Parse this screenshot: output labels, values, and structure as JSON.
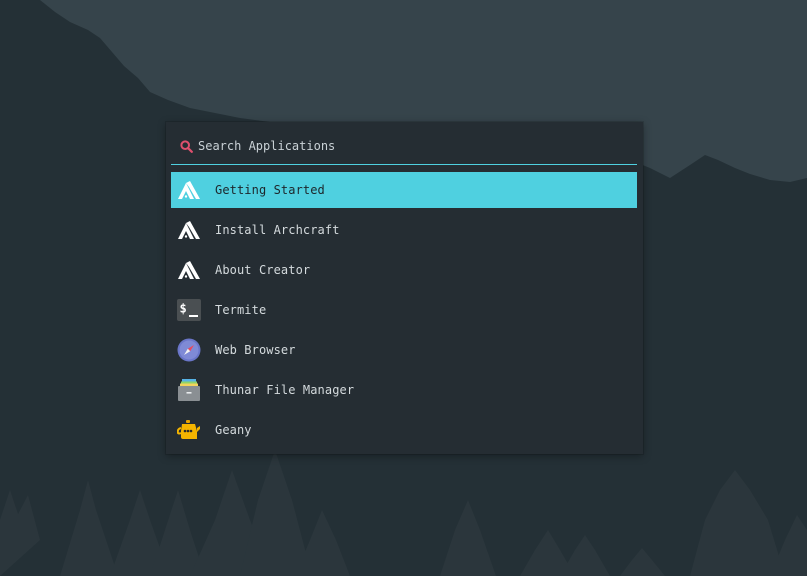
{
  "colors": {
    "accent": "#4fd0e0",
    "search_icon": "#e0506e",
    "panel_bg": "#252d33",
    "selected_text": "#1d262b",
    "text": "#d4dadd"
  },
  "search": {
    "placeholder": "Search Applications",
    "value": "",
    "icon": "search-icon"
  },
  "apps": [
    {
      "label": "Getting Started",
      "icon": "archcraft-icon",
      "selected": true
    },
    {
      "label": "Install Archcraft",
      "icon": "archcraft-icon",
      "selected": false
    },
    {
      "label": "About Creator",
      "icon": "archcraft-icon",
      "selected": false
    },
    {
      "label": "Termite",
      "icon": "terminal-icon",
      "selected": false
    },
    {
      "label": "Web Browser",
      "icon": "compass-icon",
      "selected": false
    },
    {
      "label": "Thunar File Manager",
      "icon": "file-cabinet-icon",
      "selected": false
    },
    {
      "label": "Geany",
      "icon": "teapot-icon",
      "selected": false
    }
  ]
}
